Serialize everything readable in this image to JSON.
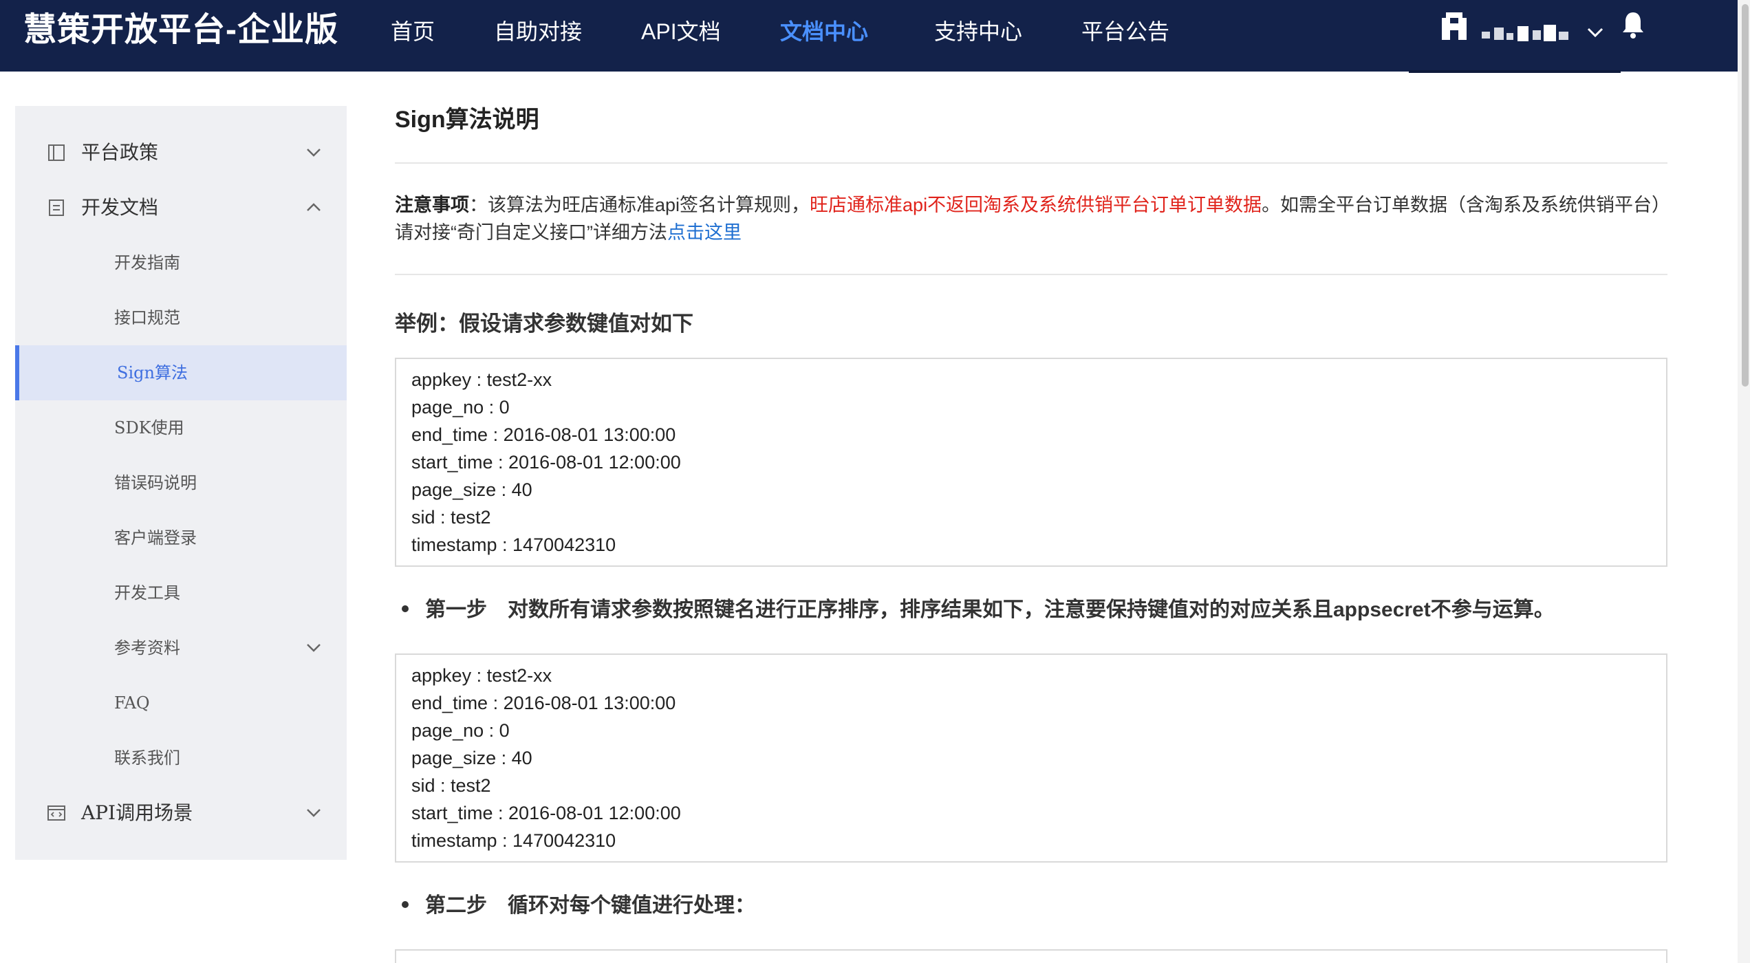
{
  "header": {
    "brand": "慧策开放平台-企业版",
    "nav": [
      {
        "label": "首页",
        "active": false
      },
      {
        "label": "自助对接",
        "active": false
      },
      {
        "label": "API文档",
        "active": false
      },
      {
        "label": "文档中心",
        "active": true
      },
      {
        "label": "支持中心",
        "active": false
      },
      {
        "label": "平台公告",
        "active": false
      }
    ]
  },
  "sidebar": {
    "groups": [
      {
        "label": "平台政策",
        "icon": "book-icon",
        "expanded": false
      },
      {
        "label": "开发文档",
        "icon": "document-icon",
        "expanded": true
      },
      {
        "label": "API调用场景",
        "icon": "code-window-icon",
        "expanded": false
      }
    ],
    "dev_docs_items": [
      {
        "label": "开发指南"
      },
      {
        "label": "接口规范"
      },
      {
        "label": "Sign算法",
        "active": true
      },
      {
        "label": "SDK使用"
      },
      {
        "label": "错误码说明"
      },
      {
        "label": "客户端登录"
      },
      {
        "label": "开发工具"
      },
      {
        "label": "参考资料",
        "has_children": true
      },
      {
        "label": "FAQ"
      },
      {
        "label": "联系我们"
      }
    ]
  },
  "content": {
    "title": "Sign算法说明",
    "notice": {
      "label": "注意事项",
      "text1": "：该算法为旺店通标准api签名计算规则，",
      "highlight": "旺店通标准api不返回淘系及系统供销平台订单订单数据",
      "text2": "。如需全平台订单数据（含淘系及系统供销平台）请对接“奇门自定义接口”详细方法",
      "link": "点击这里"
    },
    "example_heading": "举例：假设请求参数键值对如下",
    "example_params": [
      "appkey : test2-xx",
      "page_no : 0",
      "end_time : 2016-08-01 13:00:00",
      "start_time : 2016-08-01 12:00:00",
      "page_size : 40",
      "sid : test2",
      "timestamp : 1470042310"
    ],
    "step1": {
      "label": "第一步",
      "text": "对数所有请求参数按照键名进行正序排序，排序结果如下，注意要保持键值对的对应关系且appsecret不参与运算。"
    },
    "sorted_params": [
      "appkey : test2-xx",
      "end_time : 2016-08-01 13:00:00",
      "page_no : 0",
      "page_size : 40",
      "sid : test2",
      "start_time : 2016-08-01 12:00:00",
      "timestamp : 1470042310"
    ],
    "step2": {
      "label": "第二步",
      "text": "循环对每个键值进行处理："
    }
  },
  "colors": {
    "topbar": "#13224a",
    "nav_active": "#4a90ff",
    "sidebar_bg": "#eff0f3",
    "active_item_bg": "#dfe5f6",
    "active_item_text": "#3f6fe0",
    "warning_red": "#e0231b",
    "link_blue": "#1f6fd1"
  }
}
